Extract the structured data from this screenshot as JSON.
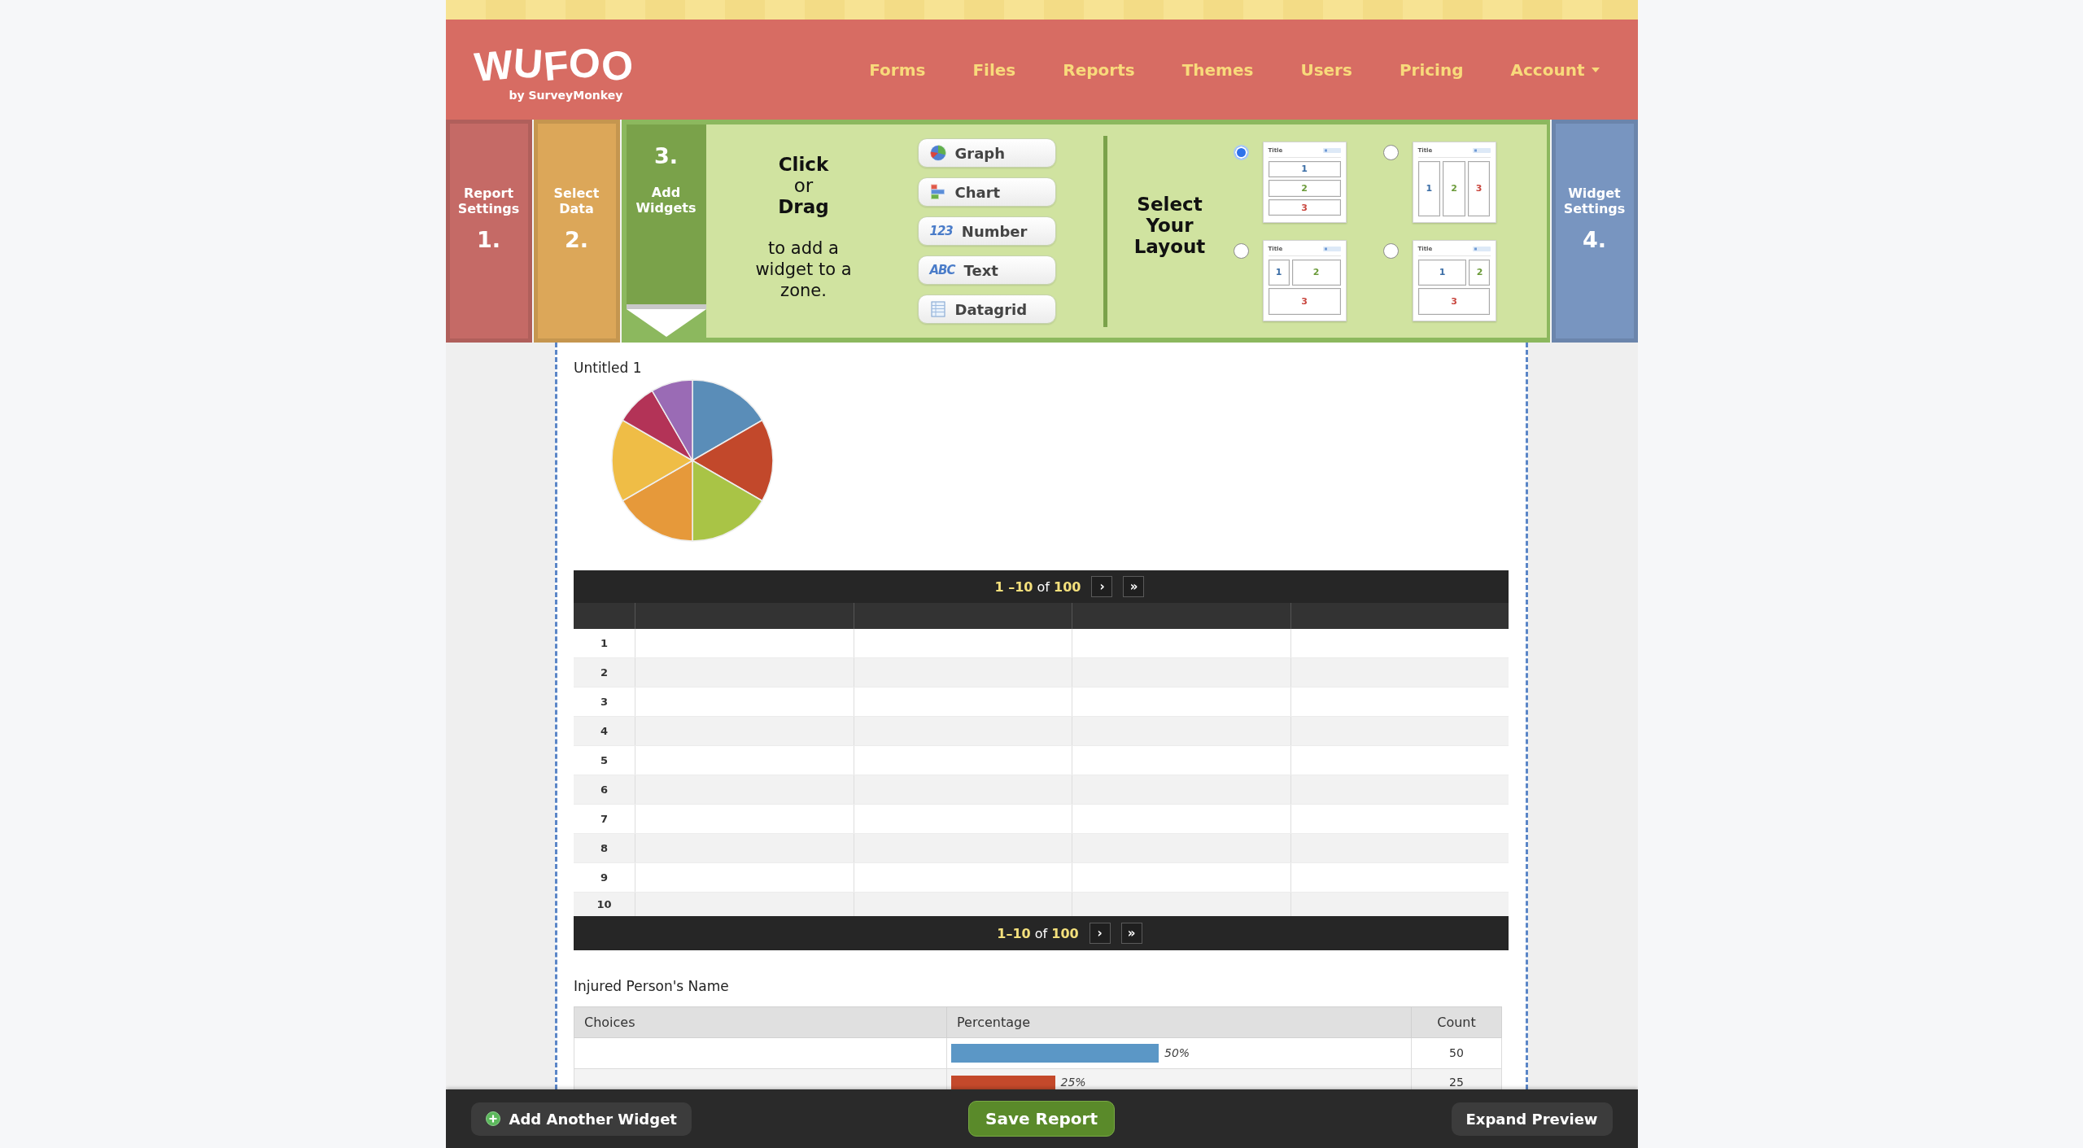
{
  "header": {
    "logo": {
      "wordmark": "WUFOO",
      "byline": "by SurveyMonkey"
    },
    "nav": [
      {
        "label": "Forms",
        "kind": "link"
      },
      {
        "label": "Files",
        "kind": "link"
      },
      {
        "label": "Reports",
        "kind": "link"
      },
      {
        "label": "Themes",
        "kind": "link"
      },
      {
        "label": "Users",
        "kind": "link"
      },
      {
        "label": "Pricing",
        "kind": "link"
      },
      {
        "label": "Account",
        "kind": "menu"
      }
    ]
  },
  "wizard": {
    "steps": [
      {
        "number": "1.",
        "label": "Report Settings",
        "color": "#c56a66",
        "selected": false
      },
      {
        "number": "2.",
        "label": "Select Data",
        "color": "#dca759",
        "selected": false
      },
      {
        "number": "3.",
        "label": "Add Widgets",
        "color": "#7aa24a",
        "selected": true
      },
      {
        "number": "4.",
        "label": "Widget Settings",
        "color": "#7895c0",
        "selected": false
      }
    ],
    "instruction": "**Click**\nor\n**Drag**",
    "instruction_detail": "to add a widget to a zone.",
    "widgets": [
      {
        "label": "Graph",
        "kind": "graph"
      },
      {
        "label": "Chart",
        "kind": "chart"
      },
      {
        "label": "Number",
        "kind": "number",
        "icon_text": "123"
      },
      {
        "label": "Text",
        "kind": "text",
        "icon_text": "ABC"
      },
      {
        "label": "Datagrid",
        "kind": "datagrid"
      }
    ],
    "layout_title": "Select Your Layout",
    "layouts": [
      {
        "kind": "rows",
        "selected": true,
        "title": "Title",
        "zones": [
          {
            "label": "1",
            "color": "#3c6ea6"
          },
          {
            "label": "2",
            "color": "#6b9b3a"
          },
          {
            "label": "3",
            "color": "#c9473f"
          }
        ]
      },
      {
        "kind": "columns",
        "selected": false,
        "title": "Title",
        "zones": [
          {
            "label": "1",
            "color": "#3c6ea6"
          },
          {
            "label": "2",
            "color": "#6b9b3a"
          },
          {
            "label": "3",
            "color": "#c9473f"
          }
        ]
      },
      {
        "kind": "split-left",
        "selected": false,
        "title": "Title",
        "zones": [
          {
            "label": "1",
            "color": "#3c6ea6"
          },
          {
            "label": "2",
            "color": "#6b9b3a"
          },
          {
            "label": "3",
            "color": "#c9473f"
          }
        ]
      },
      {
        "kind": "split-right",
        "selected": false,
        "title": "Title",
        "zones": [
          {
            "label": "1",
            "color": "#3c6ea6"
          },
          {
            "label": "2",
            "color": "#6b9b3a"
          },
          {
            "label": "3",
            "color": "#c9473f"
          }
        ]
      }
    ]
  },
  "graph_widget": {
    "title": "Untitled 1"
  },
  "datagrid": {
    "pager_top": {
      "summary": "**1 –10** of **100**",
      "next": "›",
      "last": "»"
    },
    "rows": [
      {
        "number": "1"
      },
      {
        "number": "2"
      },
      {
        "number": "3"
      },
      {
        "number": "4"
      },
      {
        "number": "5"
      },
      {
        "number": "6"
      },
      {
        "number": "7"
      },
      {
        "number": "8"
      },
      {
        "number": "9"
      },
      {
        "number": "10"
      }
    ],
    "pager_bottom": {
      "summary": "**1–10** of **100**",
      "next": "›",
      "last": "»"
    }
  },
  "choice_table": {
    "title": "Injured Person's Name",
    "columns": [
      "Choices",
      "Percentage",
      "Count"
    ],
    "rows": [
      {
        "percentage": "50%",
        "level": 0.5,
        "count": "50",
        "color": "#5b97c6"
      },
      {
        "percentage": "25%",
        "level": 0.25,
        "count": "25",
        "color": "#c4492b"
      }
    ]
  },
  "footer": {
    "buttons": [
      {
        "label": "Add Another Widget",
        "kind": "add"
      },
      {
        "label": "Save Report",
        "kind": "primary"
      },
      {
        "label": "Expand Preview",
        "kind": "secondary"
      }
    ]
  }
}
